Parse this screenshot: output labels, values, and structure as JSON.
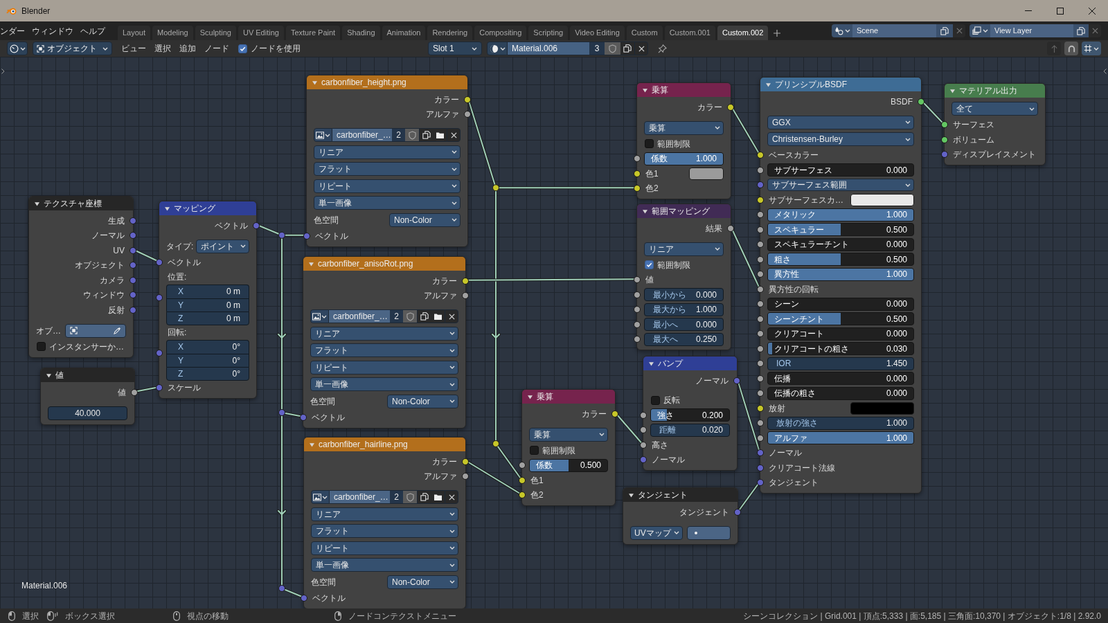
{
  "window": {
    "title": "Blender"
  },
  "menu": [
    "ンダー",
    "ウィンドウ",
    "ヘルプ"
  ],
  "workspaces": [
    {
      "label": "Layout",
      "selected": false
    },
    {
      "label": "Modeling",
      "selected": false
    },
    {
      "label": "Sculpting",
      "selected": false
    },
    {
      "label": "UV Editing",
      "selected": false
    },
    {
      "label": "Texture Paint",
      "selected": false
    },
    {
      "label": "Shading",
      "selected": false
    },
    {
      "label": "Animation",
      "selected": false
    },
    {
      "label": "Rendering",
      "selected": false
    },
    {
      "label": "Compositing",
      "selected": false
    },
    {
      "label": "Scripting",
      "selected": false
    },
    {
      "label": "Video Editing",
      "selected": false
    },
    {
      "label": "Custom",
      "selected": false
    },
    {
      "label": "Custom.001",
      "selected": false
    },
    {
      "label": "Custom.002",
      "selected": true
    }
  ],
  "scene": "Scene",
  "view_layer": "View Layer",
  "header": {
    "mode": "オブジェクト",
    "menus": [
      "ビュー",
      "選択",
      "追加",
      "ノード"
    ],
    "use_nodes": {
      "label": "ノードを使用",
      "checked": true
    },
    "slot": "Slot 1",
    "material": "Material.006",
    "users": "3"
  },
  "nodes": [
    {
      "title": "テクスチャ座標",
      "kind": "input",
      "expanded": true,
      "rows": [
        {
          "kind": "out",
          "label": "生成",
          "socket": {
            "color": "#6363c7"
          }
        },
        {
          "kind": "out",
          "label": "ノーマル",
          "socket": {
            "color": "#6363c7"
          }
        },
        {
          "kind": "out",
          "label": "UV",
          "socket": {
            "color": "#6363c7"
          }
        },
        {
          "kind": "out",
          "label": "オブジェクト",
          "socket": {
            "color": "#6363c7"
          }
        },
        {
          "kind": "out",
          "label": "カメラ",
          "socket": {
            "color": "#6363c7"
          }
        },
        {
          "kind": "out",
          "label": "ウィンドウ",
          "socket": {
            "color": "#6363c7"
          }
        },
        {
          "kind": "out",
          "label": "反射",
          "socket": {
            "color": "#6363c7"
          }
        },
        {
          "kind": "object",
          "label": "オブ…"
        },
        {
          "kind": "checkbox",
          "label": "インスタンサーか…",
          "checked": false
        }
      ]
    },
    {
      "title": "値",
      "kind": "input",
      "expanded": true,
      "rows": [
        {
          "kind": "out",
          "label": "値",
          "socket": {
            "color": "#a1a1a1"
          }
        },
        {
          "kind": "value",
          "value": "40.000"
        }
      ]
    },
    {
      "title": "マッピング",
      "kind": "vector",
      "expanded": true,
      "rows": [
        {
          "kind": "out",
          "label": "ベクトル",
          "socket": {
            "color": "#6363c7"
          }
        },
        {
          "kind": "dropdown",
          "label": "タイプ:",
          "value": "ポイント"
        },
        {
          "kind": "in",
          "label": "ベクトル",
          "socket": {
            "color": "#6363c7"
          }
        },
        {
          "kind": "heading",
          "label": "位置:"
        },
        {
          "kind": "vector",
          "socket": {
            "color": "#6363c7"
          },
          "fields": [
            {
              "label": "X",
              "value": "0 m"
            },
            {
              "label": "Y",
              "value": "0 m"
            },
            {
              "label": "Z",
              "value": "0 m"
            }
          ]
        },
        {
          "kind": "heading",
          "label": "回転:"
        },
        {
          "kind": "vector",
          "socket": {
            "color": "#6363c7"
          },
          "fields": [
            {
              "label": "X",
              "value": "0°"
            },
            {
              "label": "Y",
              "value": "0°"
            },
            {
              "label": "Z",
              "value": "0°"
            }
          ]
        },
        {
          "kind": "in",
          "label": "スケール",
          "socket": {
            "color": "#6363c7"
          }
        }
      ]
    },
    {
      "title": "carbonfiber_height.png",
      "kind": "texture",
      "expanded": true,
      "rows": [
        {
          "kind": "out",
          "label": "カラー",
          "socket": {
            "color": "#c7c729"
          }
        },
        {
          "kind": "out",
          "label": "アルファ",
          "socket": {
            "color": "#a1a1a1"
          }
        },
        {
          "kind": "image",
          "name": "carbonfiber_…",
          "users": "2"
        },
        {
          "kind": "dropdown",
          "value": "リニア"
        },
        {
          "kind": "dropdown",
          "value": "フラット"
        },
        {
          "kind": "dropdown",
          "value": "リピート"
        },
        {
          "kind": "dropdown",
          "value": "単一画像"
        },
        {
          "kind": "dropdown",
          "label": "色空間",
          "value": "Non-Color"
        },
        {
          "kind": "in",
          "label": "ベクトル",
          "socket": {
            "color": "#6363c7"
          }
        }
      ]
    },
    {
      "title": "carbonfiber_anisoRot.png",
      "kind": "texture",
      "expanded": true,
      "rows": [
        {
          "kind": "out",
          "label": "カラー",
          "socket": {
            "color": "#c7c729"
          }
        },
        {
          "kind": "out",
          "label": "アルファ",
          "socket": {
            "color": "#a1a1a1"
          }
        },
        {
          "kind": "image",
          "name": "carbonfiber_…",
          "users": "2"
        },
        {
          "kind": "dropdown",
          "value": "リニア"
        },
        {
          "kind": "dropdown",
          "value": "フラット"
        },
        {
          "kind": "dropdown",
          "value": "リピート"
        },
        {
          "kind": "dropdown",
          "value": "単一画像"
        },
        {
          "kind": "dropdown",
          "label": "色空間",
          "value": "Non-Color"
        },
        {
          "kind": "in",
          "label": "ベクトル",
          "socket": {
            "color": "#6363c7"
          }
        }
      ]
    },
    {
      "title": "carbonfiber_hairline.png",
      "kind": "texture",
      "expanded": true,
      "rows": [
        {
          "kind": "out",
          "label": "カラー",
          "socket": {
            "color": "#c7c729"
          }
        },
        {
          "kind": "out",
          "label": "アルファ",
          "socket": {
            "color": "#a1a1a1"
          }
        },
        {
          "kind": "image",
          "name": "carbonfiber_…",
          "users": "2"
        },
        {
          "kind": "dropdown",
          "value": "リニア"
        },
        {
          "kind": "dropdown",
          "value": "フラット"
        },
        {
          "kind": "dropdown",
          "value": "リピート"
        },
        {
          "kind": "dropdown",
          "value": "単一画像"
        },
        {
          "kind": "dropdown",
          "label": "色空間",
          "value": "Non-Color"
        },
        {
          "kind": "in",
          "label": "ベクトル",
          "socket": {
            "color": "#6363c7"
          }
        }
      ]
    },
    {
      "title": "乗算",
      "kind": "color",
      "expanded": true,
      "rows": [
        {
          "kind": "out",
          "label": "カラー",
          "socket": {
            "color": "#c7c729"
          }
        },
        {
          "kind": "dropdown",
          "value": "乗算"
        },
        {
          "kind": "checkbox",
          "label": "範囲制限",
          "checked": false
        },
        {
          "kind": "slider",
          "label": "係数",
          "value": "0.500",
          "level": 0.5,
          "socket": {
            "color": "#a1a1a1"
          }
        },
        {
          "kind": "in",
          "label": "色1",
          "socket": {
            "color": "#c7c729"
          }
        },
        {
          "kind": "in",
          "label": "色2",
          "socket": {
            "color": "#c7c729"
          }
        }
      ]
    },
    {
      "title": "乗算",
      "kind": "color",
      "expanded": true,
      "rows": [
        {
          "kind": "out",
          "label": "カラー",
          "socket": {
            "color": "#c7c729"
          }
        },
        {
          "kind": "dropdown",
          "value": "乗算"
        },
        {
          "kind": "checkbox",
          "label": "範囲制限",
          "checked": false
        },
        {
          "kind": "slider",
          "label": "係数",
          "value": "1.000",
          "level": 1,
          "socket": {
            "color": "#a1a1a1"
          }
        },
        {
          "kind": "swatch",
          "label": "色1",
          "color": "#9b9b9b",
          "socket": {
            "color": "#c7c729"
          }
        },
        {
          "kind": "in",
          "label": "色2",
          "socket": {
            "color": "#c7c729"
          }
        }
      ]
    },
    {
      "title": "範囲マッピング",
      "kind": "converter",
      "expanded": true,
      "rows": [
        {
          "kind": "out",
          "label": "結果",
          "socket": {
            "color": "#a1a1a1"
          }
        },
        {
          "kind": "dropdown",
          "value": "リニア"
        },
        {
          "kind": "checkbox",
          "label": "範囲制限",
          "checked": true
        },
        {
          "kind": "in",
          "label": "値",
          "socket": {
            "color": "#a1a1a1"
          }
        },
        {
          "kind": "number",
          "label": "最小から",
          "value": "0.000",
          "socket": {
            "color": "#a1a1a1"
          }
        },
        {
          "kind": "number",
          "label": "最大から",
          "value": "1.000",
          "socket": {
            "color": "#a1a1a1"
          }
        },
        {
          "kind": "number",
          "label": "最小へ",
          "value": "0.000",
          "socket": {
            "color": "#a1a1a1"
          }
        },
        {
          "kind": "number",
          "label": "最大へ",
          "value": "0.250",
          "socket": {
            "color": "#a1a1a1"
          }
        }
      ]
    },
    {
      "title": "バンプ",
      "kind": "vector",
      "expanded": true,
      "rows": [
        {
          "kind": "out",
          "label": "ノーマル",
          "socket": {
            "color": "#6363c7"
          }
        },
        {
          "kind": "checkbox",
          "label": "反転",
          "checked": false
        },
        {
          "kind": "slider",
          "label": "強さ",
          "value": "0.200",
          "level": 0.2,
          "socket": {
            "color": "#a1a1a1"
          }
        },
        {
          "kind": "number",
          "label": "距離",
          "value": "0.020",
          "socket": {
            "color": "#a1a1a1"
          }
        },
        {
          "kind": "in",
          "label": "高さ",
          "socket": {
            "color": "#a1a1a1"
          }
        },
        {
          "kind": "in",
          "label": "ノーマル",
          "socket": {
            "color": "#6363c7"
          }
        }
      ]
    },
    {
      "title": "タンジェント",
      "kind": "input",
      "expanded": true,
      "rows": [
        {
          "kind": "out",
          "label": "タンジェント",
          "socket": {
            "color": "#6363c7"
          }
        },
        {
          "kind": "uvmap",
          "mode": "UVマップ"
        }
      ]
    },
    {
      "title": "プリンシプルBSDF",
      "kind": "shader",
      "expanded": true,
      "rows": [
        {
          "kind": "out",
          "label": "BSDF",
          "socket": {
            "color": "#63c763"
          }
        },
        {
          "kind": "dropdown",
          "value": "GGX"
        },
        {
          "kind": "dropdown",
          "value": "Christensen-Burley"
        },
        {
          "kind": "in",
          "label": "ベースカラー",
          "socket": {
            "color": "#c7c729"
          }
        },
        {
          "kind": "slider",
          "label": "サブサーフェス",
          "value": "0.000",
          "level": 0,
          "socket": {
            "color": "#a1a1a1"
          }
        },
        {
          "kind": "dropdown",
          "value": "サブサーフェス範囲",
          "socket": {
            "color": "#6363c7"
          }
        },
        {
          "kind": "swatch",
          "label": "サブサーフェスカ…",
          "color": "#e8e8e8",
          "socket": {
            "color": "#c7c729"
          }
        },
        {
          "kind": "slider",
          "label": "メタリック",
          "value": "1.000",
          "level": 1,
          "socket": {
            "color": "#a1a1a1"
          }
        },
        {
          "kind": "slider",
          "label": "スペキュラー",
          "value": "0.500",
          "level": 0.5,
          "socket": {
            "color": "#a1a1a1"
          }
        },
        {
          "kind": "slider",
          "label": "スペキュラーチント",
          "value": "0.000",
          "level": 0,
          "socket": {
            "color": "#a1a1a1"
          }
        },
        {
          "kind": "slider",
          "label": "粗さ",
          "value": "0.500",
          "level": 0.5,
          "socket": {
            "color": "#a1a1a1"
          }
        },
        {
          "kind": "slider",
          "label": "異方性",
          "value": "1.000",
          "level": 1,
          "socket": {
            "color": "#a1a1a1"
          }
        },
        {
          "kind": "in",
          "label": "異方性の回転",
          "socket": {
            "color": "#a1a1a1"
          }
        },
        {
          "kind": "slider",
          "label": "シーン",
          "value": "0.000",
          "level": 0,
          "socket": {
            "color": "#a1a1a1"
          }
        },
        {
          "kind": "slider",
          "label": "シーンチント",
          "value": "0.500",
          "level": 0.5,
          "socket": {
            "color": "#a1a1a1"
          }
        },
        {
          "kind": "slider",
          "label": "クリアコート",
          "value": "0.000",
          "level": 0,
          "socket": {
            "color": "#a1a1a1"
          }
        },
        {
          "kind": "slider",
          "label": "クリアコートの粗さ",
          "value": "0.030",
          "level": 0.03,
          "socket": {
            "color": "#a1a1a1"
          }
        },
        {
          "kind": "number",
          "label": "IOR",
          "value": "1.450",
          "socket": {
            "color": "#a1a1a1"
          }
        },
        {
          "kind": "slider",
          "label": "伝播",
          "value": "0.000",
          "level": 0,
          "socket": {
            "color": "#a1a1a1"
          }
        },
        {
          "kind": "slider",
          "label": "伝播の粗さ",
          "value": "0.000",
          "level": 0,
          "socket": {
            "color": "#a1a1a1"
          }
        },
        {
          "kind": "swatch",
          "label": "放射",
          "color": "#000000",
          "socket": {
            "color": "#c7c729"
          }
        },
        {
          "kind": "number",
          "label": "放射の強さ",
          "value": "1.000",
          "socket": {
            "color": "#a1a1a1"
          }
        },
        {
          "kind": "slider",
          "label": "アルファ",
          "value": "1.000",
          "level": 1,
          "socket": {
            "color": "#a1a1a1"
          }
        },
        {
          "kind": "in",
          "label": "ノーマル",
          "socket": {
            "color": "#6363c7"
          }
        },
        {
          "kind": "in",
          "label": "クリアコート法線",
          "socket": {
            "color": "#6363c7"
          }
        },
        {
          "kind": "in",
          "label": "タンジェント",
          "socket": {
            "color": "#6363c7"
          }
        }
      ]
    },
    {
      "title": "マテリアル出力",
      "kind": "output",
      "expanded": true,
      "rows": [
        {
          "kind": "dropdown",
          "value": "全て"
        },
        {
          "kind": "in",
          "label": "サーフェス",
          "socket": {
            "color": "#63c763"
          }
        },
        {
          "kind": "in",
          "label": "ボリューム",
          "socket": {
            "color": "#63c763"
          }
        },
        {
          "kind": "in",
          "label": "ディスプレイスメント",
          "socket": {
            "color": "#6363c7"
          }
        }
      ]
    }
  ],
  "canvas_label": "Material.006",
  "status_bar": {
    "hints": [
      {
        "label": "選択",
        "kind": "left"
      },
      {
        "label": "ボックス選択",
        "kind": "drag"
      },
      {
        "label": "視点の移動",
        "kind": "middle"
      },
      {
        "label": "ノードコンテクストメニュー",
        "kind": "right"
      }
    ],
    "stats": "シーンコレクション | Grid.001 | 頂点:5,333 | 面:5,185 | 三角面:10,370 | オブジェクト:1/8 | 2.92.0"
  }
}
